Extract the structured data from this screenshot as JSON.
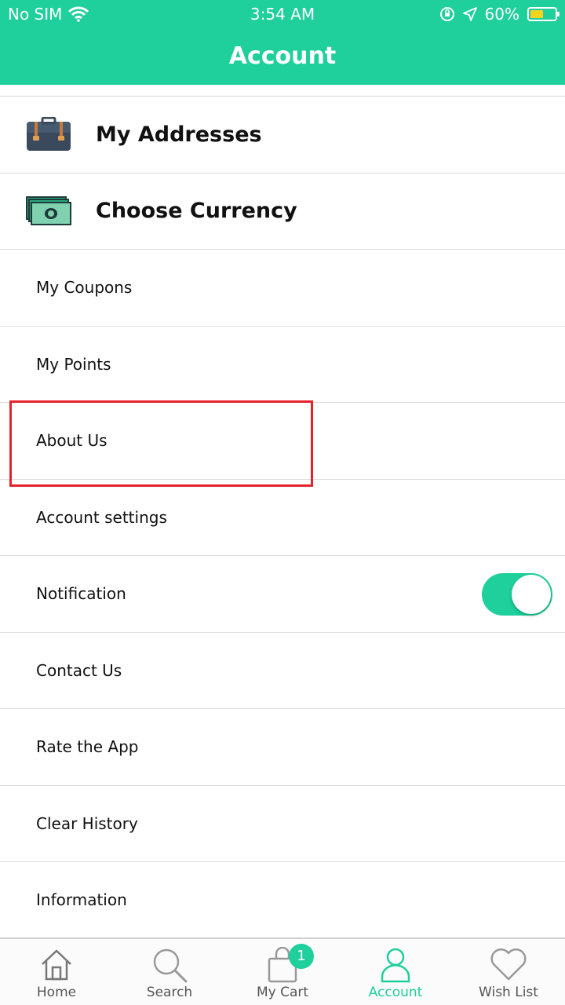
{
  "status": {
    "carrier": "No SIM",
    "time": "3:54 AM",
    "battery_percent": "60%",
    "battery_level": 0.6
  },
  "header": {
    "title": "Account"
  },
  "menu": {
    "addresses": "My Addresses",
    "currency": "Choose Currency",
    "coupons": "My Coupons",
    "points": "My Points",
    "about": "About Us",
    "account_settings": "Account settings",
    "notification": "Notification",
    "notification_on": true,
    "contact": "Contact Us",
    "rate": "Rate the App",
    "clear_history": "Clear History",
    "information": "Information"
  },
  "tabs": [
    {
      "label": "Home",
      "icon": "home-icon"
    },
    {
      "label": "Search",
      "icon": "search-icon"
    },
    {
      "label": "My Cart",
      "icon": "shopping-bag-icon",
      "badge": "1"
    },
    {
      "label": "Account",
      "icon": "user-icon",
      "active": true
    },
    {
      "label": "Wish List",
      "icon": "heart-icon"
    }
  ],
  "colors": {
    "accent": "#1fcf9c",
    "highlight": "#e5222a",
    "battery": "#f7d21e"
  }
}
